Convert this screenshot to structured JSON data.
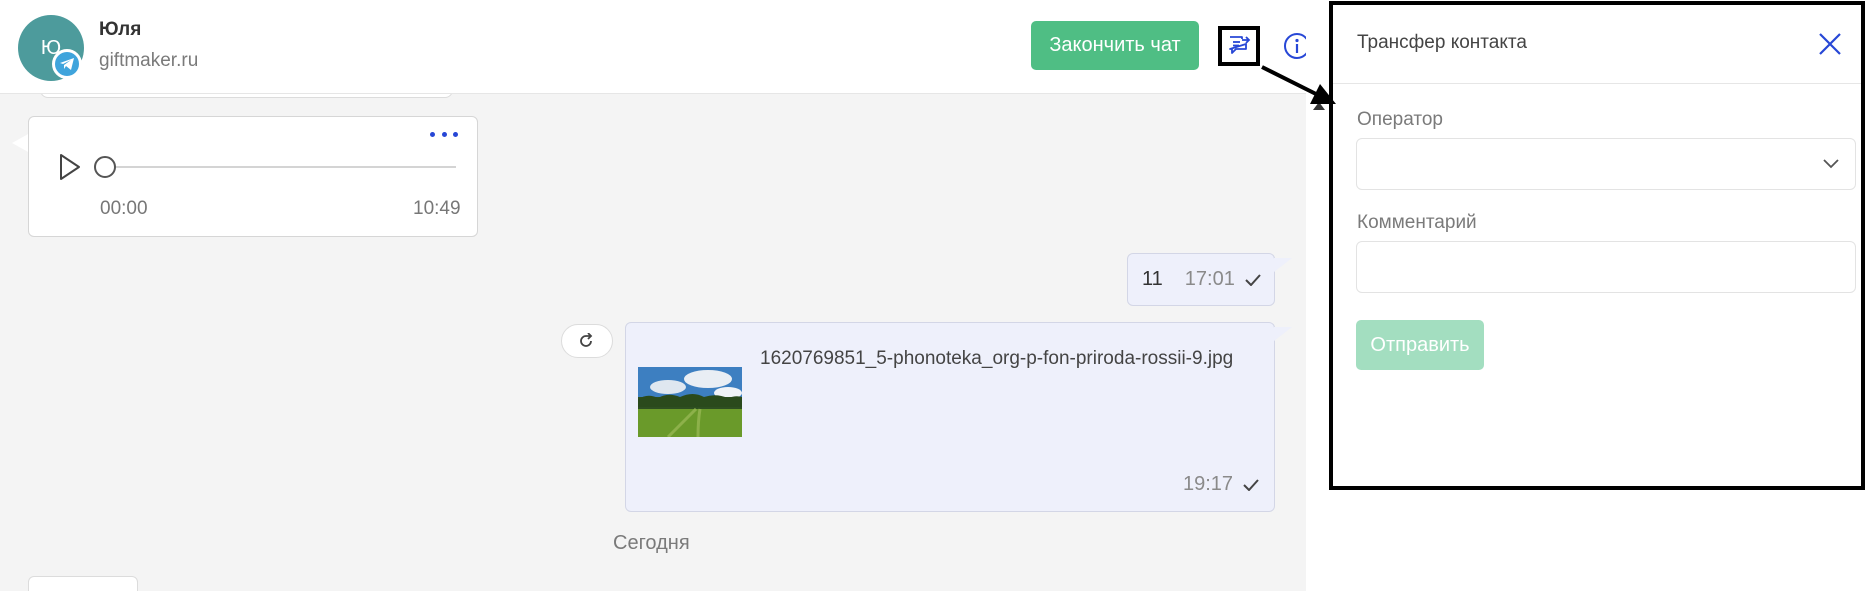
{
  "header": {
    "avatar_initial": "Ю",
    "contact_name": "Юля",
    "contact_site": "giftmaker.ru",
    "end_chat_label": "Закончить чат",
    "channel_icon": "telegram-icon",
    "transfer_icon": "chat-transfer-icon",
    "info_icon": "info-icon"
  },
  "messages": {
    "audio": {
      "current_time": "00:00",
      "duration": "10:49",
      "progress": 0
    },
    "text_out": {
      "text": "11",
      "time": "17:01"
    },
    "file_out": {
      "filename": "1620769851_5-phonoteka_org-p-fon-priroda-rossii-9.jpg",
      "time": "19:17"
    },
    "day_separator": "Сегодня"
  },
  "transfer_panel": {
    "title": "Трансфер контакта",
    "operator_label": "Оператор",
    "operator_value": "",
    "comment_label": "Комментарий",
    "comment_value": "",
    "send_label": "Отправить"
  },
  "colors": {
    "accent_green": "#4fbe84",
    "disabled_green": "#a3dec0",
    "outgoing_bubble": "#eef0fb",
    "link_blue": "#2747d6",
    "avatar": "#4d9b9c",
    "telegram": "#3fa4dc"
  }
}
